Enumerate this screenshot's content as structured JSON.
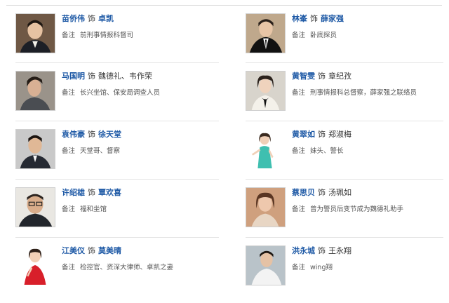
{
  "note_label": "备注",
  "as_word": "饰",
  "cast": [
    {
      "actor": "苗侨伟",
      "role": "卓凯",
      "role_is_link": true,
      "note": "前刑事情报科督司",
      "photo_icon": "actor-portrait-dark-suit"
    },
    {
      "actor": "林峯",
      "role": "薛家强",
      "role_is_link": true,
      "note": "卧底探员",
      "photo_icon": "actor-portrait-black-tie"
    },
    {
      "actor": "马国明",
      "role": "魏德礼、韦作荣",
      "role_is_link": false,
      "note": "长兴坐馆、保安局调查人员",
      "photo_icon": "actor-portrait-grey-shirt"
    },
    {
      "actor": "黄智雯",
      "role": "章纪孜",
      "role_is_link": false,
      "note": "刑事情报科总督察，薛家强之联络员",
      "photo_icon": "actor-portrait-bow-blouse"
    },
    {
      "actor": "袁伟豪",
      "role": "徐天堂",
      "role_is_link": true,
      "note": "天堂哥、督察",
      "photo_icon": "actor-portrait-suit-grey-bg"
    },
    {
      "actor": "黄翠如",
      "role": "郑淑梅",
      "role_is_link": false,
      "note": "妹头、警长",
      "photo_icon": "actress-portrait-teal-dress"
    },
    {
      "actor": "许绍雄",
      "role": "覃欢喜",
      "role_is_link": true,
      "note": "福和坐馆",
      "photo_icon": "actor-portrait-glasses"
    },
    {
      "actor": "蔡思贝",
      "role": "汤珮如",
      "role_is_link": false,
      "note": "曾为警员后变节成为魏德礼助手",
      "photo_icon": "actress-portrait-short-hair"
    },
    {
      "actor": "江美仪",
      "role": "莫美晴",
      "role_is_link": true,
      "note": "检控官、资深大律师、卓凯之妻",
      "photo_icon": "actress-portrait-red-gown"
    },
    {
      "actor": "洪永城",
      "role": "王永翔",
      "role_is_link": false,
      "note": "wing翔",
      "photo_icon": "actor-portrait-white-shirt"
    }
  ]
}
